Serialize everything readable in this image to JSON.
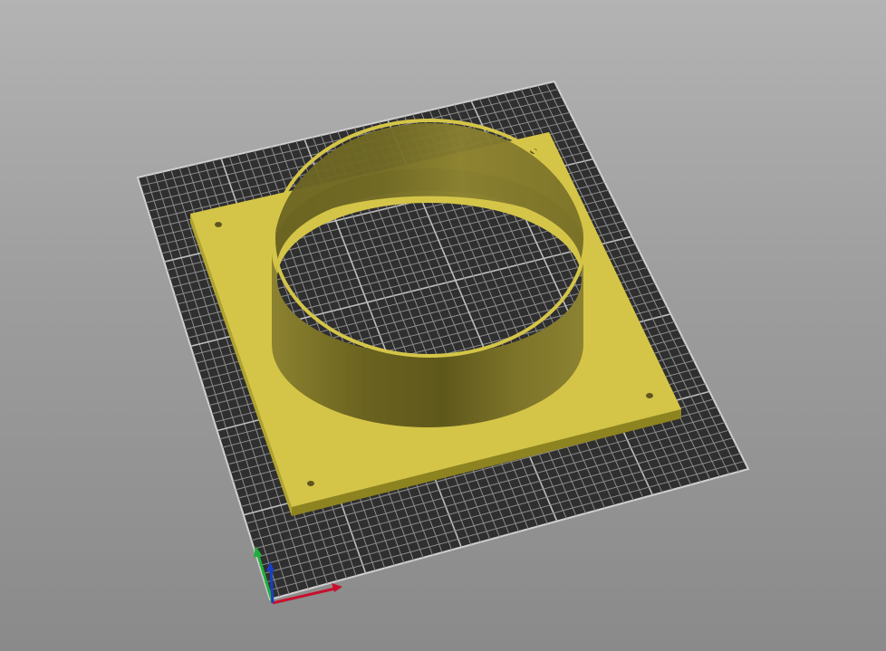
{
  "viewport": {
    "background_top": "#b3b3b3",
    "background_bottom": "#8a8a8a"
  },
  "bed": {
    "fill": "#2f2f2f",
    "grid_line": "#8c8c8c",
    "major_grid_line": "#bdbdbd",
    "edge": "#d0d0d0"
  },
  "model": {
    "type": "flange-adapter",
    "plate_color": "#d4c548",
    "plate_side_color": "#9a8f24",
    "ring_color": "#8a7f2a",
    "ring_dark_color": "#615a1e",
    "screw_holes": 4
  },
  "axes": {
    "x_color": "#c8102e",
    "y_color": "#1fae3a",
    "z_color": "#1a3fc4"
  }
}
